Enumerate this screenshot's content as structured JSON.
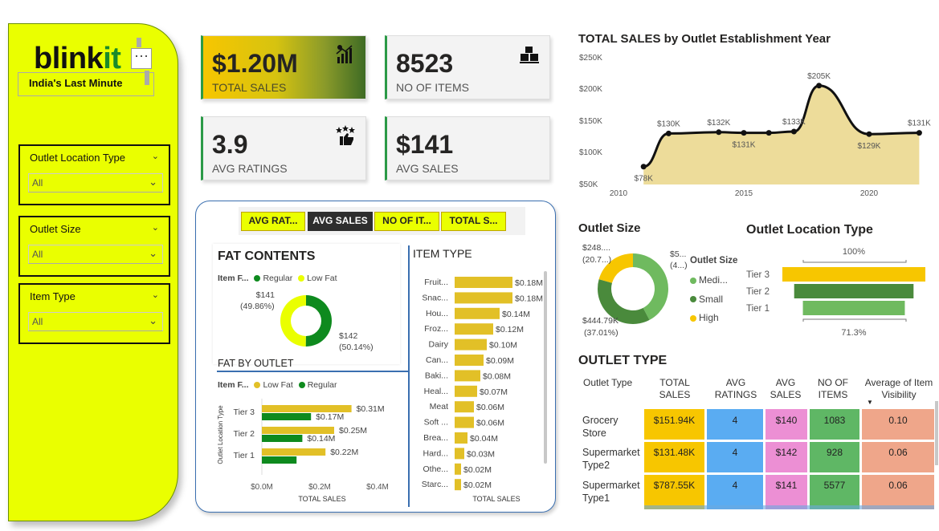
{
  "sidebar": {
    "logo_main": "blink",
    "logo_accent": "it",
    "more": "⋯",
    "tagline": "India's Last Minute",
    "filters": [
      {
        "title": "Outlet Location Type",
        "value": "All"
      },
      {
        "title": "Outlet Size",
        "value": "All"
      },
      {
        "title": "Item Type",
        "value": "All"
      }
    ]
  },
  "kpis": {
    "total_sales": {
      "value": "$1.20M",
      "label": "TOTAL SALES",
      "icon": "chart-growth-icon"
    },
    "no_of_items": {
      "value": "8523",
      "label": "NO OF ITEMS",
      "icon": "boxes-icon"
    },
    "avg_ratings": {
      "value": "3.9",
      "label": "AVG RATINGS",
      "icon": "thumbs-up-stars-icon"
    },
    "avg_sales": {
      "value": "$141",
      "label": "AVG SALES"
    }
  },
  "tabs": [
    {
      "label": "AVG RAT...",
      "active": false
    },
    {
      "label": "AVG SALES",
      "active": true
    },
    {
      "label": "NO OF IT...",
      "active": false
    },
    {
      "label": "TOTAL S...",
      "active": false
    }
  ],
  "fat_contents": {
    "title": "FAT CONTENTS",
    "legend_title": "Item F...",
    "legend": [
      "Regular",
      "Low Fat"
    ],
    "label_low_fat_value": "$141",
    "label_low_fat_pct": "(49.86%)",
    "label_regular_value": "$142",
    "label_regular_pct": "(50.14%)"
  },
  "fat_by_outlet": {
    "title": "FAT BY OUTLET",
    "legend_title": "Item F...",
    "legend": [
      "Low Fat",
      "Regular"
    ],
    "ylabel": "Outlet Location Type",
    "xlabel": "TOTAL SALES",
    "ticks": [
      "$0.0M",
      "$0.2M",
      "$0.4M"
    ]
  },
  "item_type": {
    "title": "ITEM TYPE",
    "xlabel": "TOTAL SALES"
  },
  "line_chart": {
    "title": "TOTAL SALES by Outlet Establishment Year",
    "y_ticks": [
      "$250K",
      "$200K",
      "$150K",
      "$100K",
      "$50K"
    ],
    "x_ticks": [
      "2010",
      "2015",
      "2020"
    ]
  },
  "outlet_size": {
    "title": "Outlet Size",
    "legend_title": "Outlet Size",
    "label_medium_value": "$5...",
    "label_medium_pct": "(4...)",
    "label_high_value": "$248....",
    "label_high_pct": "(20.7...)",
    "label_small_value": "$444.79K",
    "label_small_pct": "(37.01%)"
  },
  "outlet_location": {
    "title": "Outlet Location Type",
    "top_pct": "100%",
    "bottom_pct": "71.3%"
  },
  "outlet_type": {
    "title": "OUTLET TYPE",
    "headers": [
      "Outlet Type",
      "TOTAL SALES",
      "AVG RATINGS",
      "AVG SALES",
      "NO OF ITEMS",
      "Average of Item Visibility"
    ],
    "rows": [
      {
        "name": "Grocery Store",
        "total": "$151.94K",
        "rating": "4",
        "avg": "$140",
        "items": "1083",
        "vis": "0.10"
      },
      {
        "name": "Supermarket Type2",
        "total": "$131.48K",
        "rating": "4",
        "avg": "$142",
        "items": "928",
        "vis": "0.06"
      },
      {
        "name": "Supermarket Type1",
        "total": "$787.55K",
        "rating": "4",
        "avg": "$141",
        "items": "5577",
        "vis": "0.06"
      }
    ]
  },
  "colors": {
    "accent_yellow": "#eaff00",
    "gold": "#e2c027",
    "green_dark": "#0e8a1e",
    "green_mid": "#4a8a3c",
    "green_light": "#6fba5f",
    "sand": "#eddc9a"
  },
  "chart_data": [
    {
      "type": "area",
      "title": "TOTAL SALES by Outlet Establishment Year",
      "x": [
        2011,
        2012,
        2014,
        2015,
        2016,
        2017,
        2018,
        2020,
        2022
      ],
      "values": [
        78,
        130,
        132,
        131,
        131,
        133,
        205,
        129,
        131
      ],
      "data_labels": [
        "$78K",
        "$130K",
        "$132K",
        "$131K",
        "",
        "$133K",
        "$205K",
        "$129K",
        "$131K"
      ],
      "ylim": [
        50,
        250
      ],
      "xlabel": "",
      "ylabel": ""
    },
    {
      "type": "pie",
      "title": "FAT CONTENTS",
      "categories": [
        "Low Fat",
        "Regular"
      ],
      "values": [
        141,
        142
      ],
      "percents": [
        49.86,
        50.14
      ]
    },
    {
      "type": "bar",
      "title": "FAT BY OUTLET",
      "categories": [
        "Tier 3",
        "Tier 2",
        "Tier 1"
      ],
      "series": [
        {
          "name": "Low Fat",
          "values": [
            0.31,
            0.25,
            0.22
          ],
          "labels": [
            "$0.31M",
            "$0.25M",
            "$0.22M"
          ]
        },
        {
          "name": "Regular",
          "values": [
            0.17,
            0.14,
            0.12
          ],
          "labels": [
            "$0.17M",
            "$0.14M",
            ""
          ]
        }
      ],
      "xlim": [
        0,
        0.4
      ]
    },
    {
      "type": "bar",
      "title": "ITEM TYPE",
      "categories": [
        "Fruit...",
        "Snac...",
        "Hou...",
        "Froz...",
        "Dairy",
        "Can...",
        "Baki...",
        "Heal...",
        "Meat",
        "Soft ...",
        "Brea...",
        "Hard...",
        "Othe...",
        "Starc..."
      ],
      "values": [
        0.18,
        0.18,
        0.14,
        0.12,
        0.1,
        0.09,
        0.08,
        0.07,
        0.06,
        0.06,
        0.04,
        0.03,
        0.02,
        0.02
      ],
      "labels": [
        "$0.18M",
        "$0.18M",
        "$0.14M",
        "$0.12M",
        "$0.10M",
        "$0.09M",
        "$0.08M",
        "$0.07M",
        "$0.06M",
        "$0.06M",
        "$0.04M",
        "$0.03M",
        "$0.02M",
        "$0.02M"
      ]
    },
    {
      "type": "pie",
      "title": "Outlet Size",
      "categories": [
        "Medium",
        "Small",
        "High"
      ],
      "values": [
        507,
        444.79,
        248
      ],
      "percents": [
        42.3,
        37.01,
        20.7
      ],
      "legend": [
        "Medi...",
        "Small",
        "High"
      ]
    },
    {
      "type": "bar",
      "title": "Outlet Location Type",
      "categories": [
        "Tier 3",
        "Tier 2",
        "Tier 1"
      ],
      "values": [
        100,
        83.5,
        71.3
      ]
    }
  ]
}
